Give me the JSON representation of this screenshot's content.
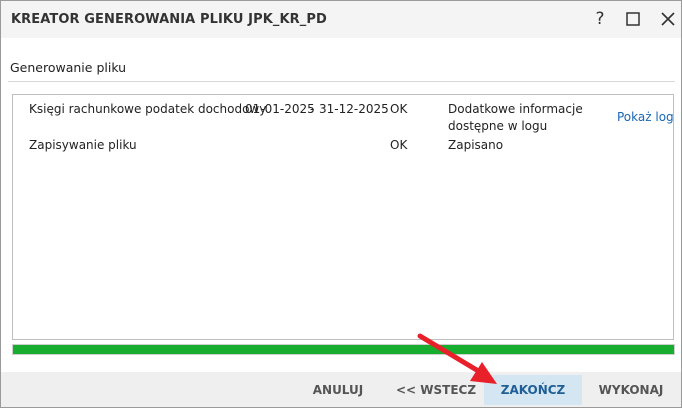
{
  "window": {
    "title": "KREATOR GENEROWANIA PLIKU JPK_KR_PD",
    "help_label": "?"
  },
  "section": {
    "title": "Generowanie pliku"
  },
  "log_rows": [
    {
      "name": "Księgi rachunkowe podatek dochodowy",
      "date_from": "01-01-2025",
      "separator": "-",
      "date_to": "31-12-2025",
      "status": "OK",
      "info": "Dodatkowe informacje dostępne w logu",
      "link": "Pokaż log"
    },
    {
      "name": "Zapisywanie pliku",
      "status": "OK",
      "info": "Zapisano"
    }
  ],
  "progress": {
    "value_percent": 100,
    "color": "#17ad2f"
  },
  "footer": {
    "cancel_label": "ANULUJ",
    "back_label": "<< WSTECZ",
    "finish_label": "ZAKOŃCZ",
    "execute_label": "WYKONAJ"
  },
  "colors": {
    "accent_link": "#1a67b4",
    "primary_button_bg": "#d3e6f2",
    "annotation_arrow": "#e8202a"
  },
  "icons": {
    "maximize": "maximize-icon",
    "close": "close-icon",
    "arrow": "red-annotation-arrow"
  }
}
